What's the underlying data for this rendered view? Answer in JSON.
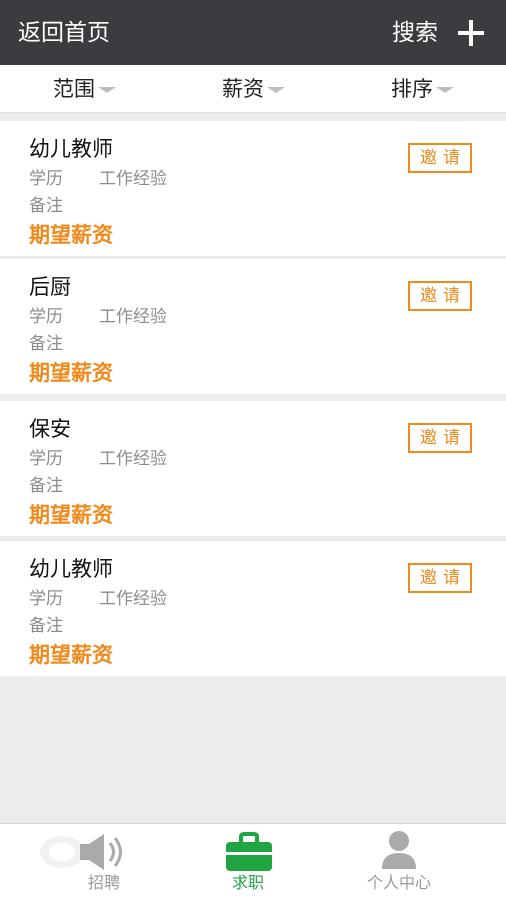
{
  "header": {
    "back_label": "返回首页",
    "search_label": "搜索"
  },
  "filters": [
    {
      "label": "范围"
    },
    {
      "label": "薪资"
    },
    {
      "label": "排序"
    }
  ],
  "jobs": [
    {
      "title": "幼儿教师",
      "education": "学历",
      "experience": "工作经验",
      "note": "备注",
      "salary": "期望薪资",
      "invite": "邀请"
    },
    {
      "title": "后厨",
      "education": "学历",
      "experience": "工作经验",
      "note": "备注",
      "salary": "期望薪资",
      "invite": "邀请"
    },
    {
      "title": "保安",
      "education": "学历",
      "experience": "工作经验",
      "note": "备注",
      "salary": "期望薪资",
      "invite": "邀请"
    },
    {
      "title": "幼儿教师",
      "education": "学历",
      "experience": "工作经验",
      "note": "备注",
      "salary": "期望薪资",
      "invite": "邀请"
    }
  ],
  "tabbar": {
    "tabs": [
      {
        "label": "招聘",
        "icon": "speaker-icon",
        "active": false
      },
      {
        "label": "求职",
        "icon": "briefcase-icon",
        "active": true
      },
      {
        "label": "个人中心",
        "icon": "person-icon",
        "active": false
      }
    ]
  },
  "colors": {
    "header": "#3a3c40",
    "accent": "#f08a1c",
    "active_tab": "#21a442"
  }
}
